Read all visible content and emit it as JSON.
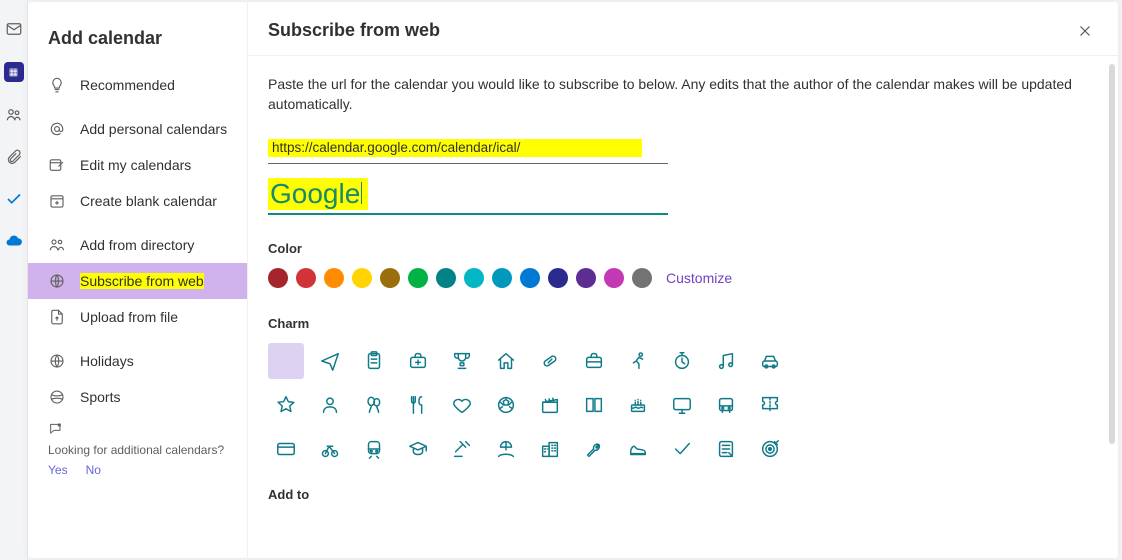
{
  "rail": {
    "icons": [
      "mail",
      "calendar",
      "people",
      "attachment",
      "todo",
      "cloud",
      "apps"
    ]
  },
  "sidebar": {
    "title": "Add calendar",
    "items": [
      {
        "id": "recommended",
        "label": "Recommended"
      },
      {
        "id": "personal",
        "label": "Add personal calendars"
      },
      {
        "id": "editmy",
        "label": "Edit my calendars"
      },
      {
        "id": "blank",
        "label": "Create blank calendar"
      },
      {
        "id": "directory",
        "label": "Add from directory"
      },
      {
        "id": "subscribe",
        "label": "Subscribe from web"
      },
      {
        "id": "upload",
        "label": "Upload from file"
      },
      {
        "id": "holidays",
        "label": "Holidays"
      },
      {
        "id": "sports",
        "label": "Sports"
      }
    ],
    "selected_id": "subscribe",
    "footer": {
      "question": "Looking for additional calendars?",
      "yes": "Yes",
      "no": "No"
    }
  },
  "main": {
    "title": "Subscribe from web",
    "description": "Paste the url for the calendar you would like to subscribe to below. Any edits that the author of the calendar makes will be updated automatically.",
    "url_value": "https://calendar.google.com/calendar/ical/",
    "name_value": "Google",
    "color_label": "Color",
    "colors": [
      "#a4262c",
      "#d13438",
      "#ff8c00",
      "#ffd400",
      "#986f0b",
      "#00b344",
      "#038387",
      "#00b7c3",
      "#0099bc",
      "#0078d4",
      "#2b2a8e",
      "#5c2e91",
      "#c239b3",
      "#737373"
    ],
    "customize": "Customize",
    "charm_label": "Charm",
    "charms": [
      "none",
      "plane",
      "clipboard",
      "briefcase-med",
      "trophy",
      "home",
      "pill",
      "briefcase",
      "running",
      "stopwatch",
      "music",
      "car",
      "star",
      "person",
      "balloons",
      "utensils",
      "heart",
      "soccer",
      "clapper",
      "book",
      "cake",
      "monitor",
      "bus",
      "ticket",
      "card",
      "bike",
      "train",
      "gradcap",
      "gavel",
      "beach",
      "buildings",
      "wrench",
      "shoe",
      "checkmark",
      "notepad",
      "target"
    ],
    "selected_charm": "none",
    "addto_label": "Add to"
  }
}
